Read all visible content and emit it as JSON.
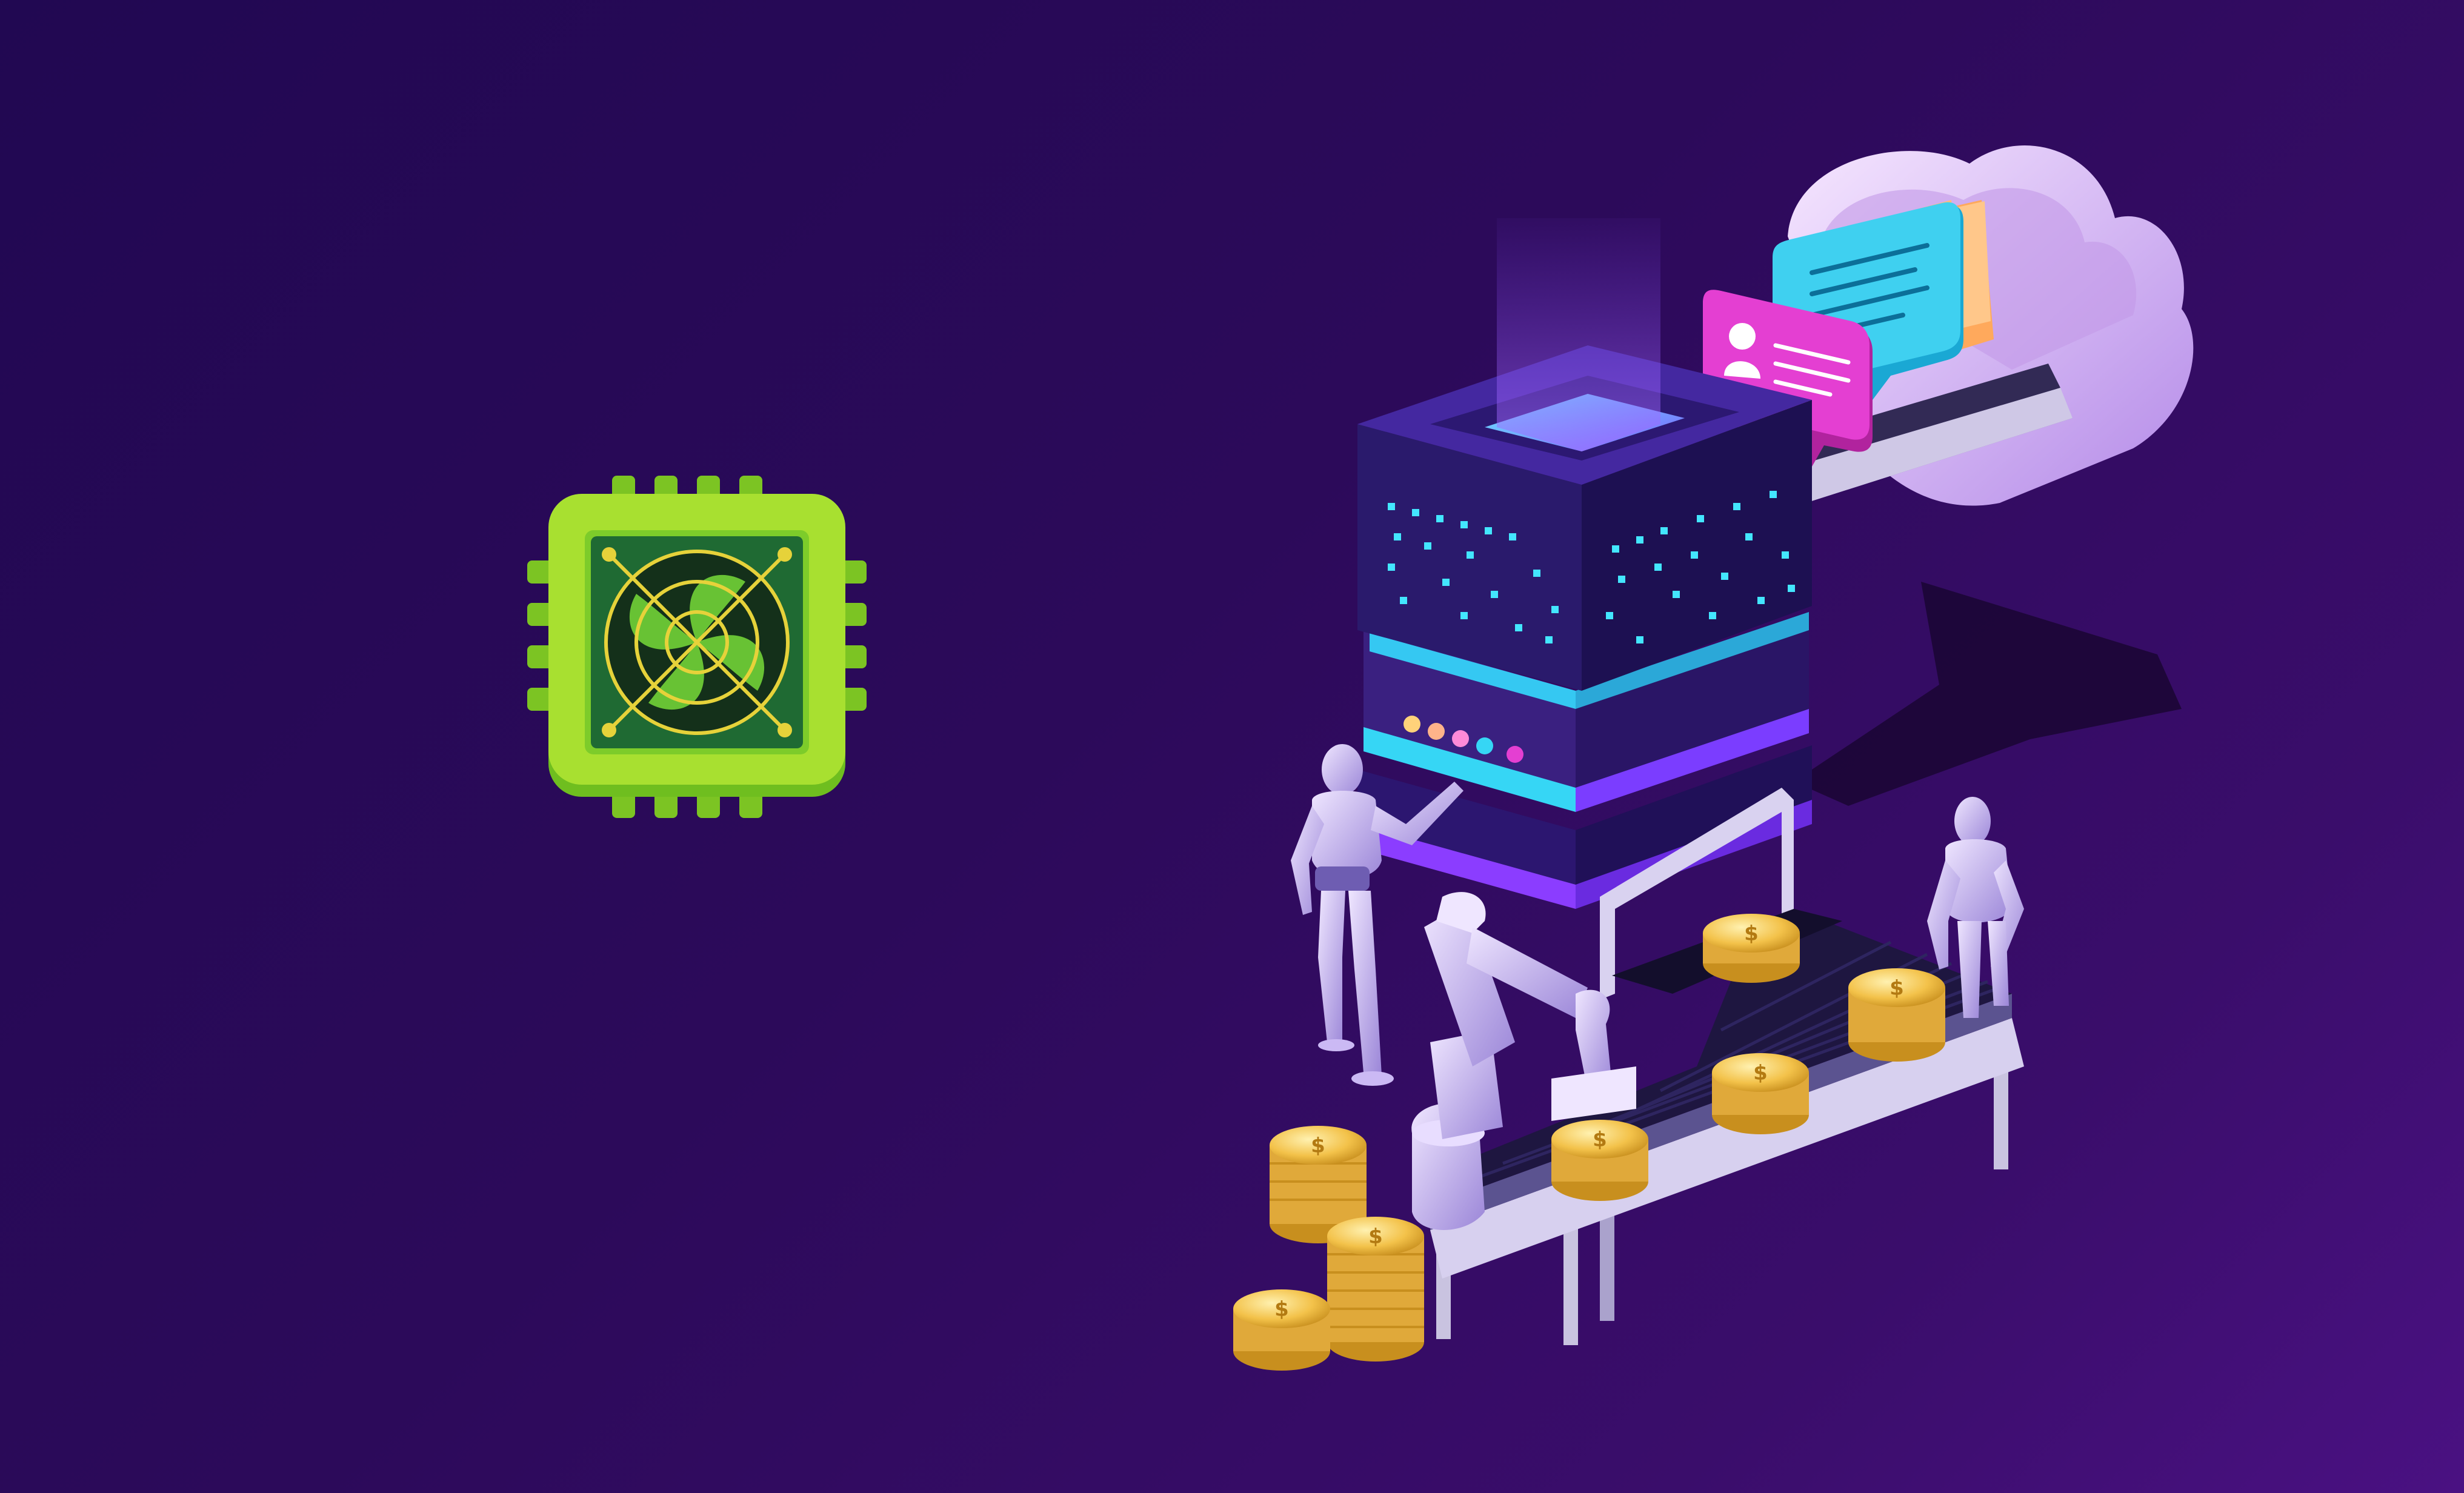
{
  "illustration": {
    "theme": "isometric crypto mining server with robots, conveyor belt of gold coins and cloud data",
    "icons": [
      "cpu-chip-fan-icon",
      "user-profile-icon",
      "image-icon",
      "gold-coin-icon"
    ],
    "palette": {
      "background": "#2a0a5a",
      "chip_green": "#9be22b",
      "server_purple": "#3b1f8a",
      "neon_cyan": "#36d6f5",
      "coin_gold": "#f2c14a",
      "robot_lilac": "#c8b6f0",
      "bubble_pink": "#e23fd0",
      "bubble_cyan": "#2fc6ea",
      "card_peach": "#ffc78a"
    }
  }
}
